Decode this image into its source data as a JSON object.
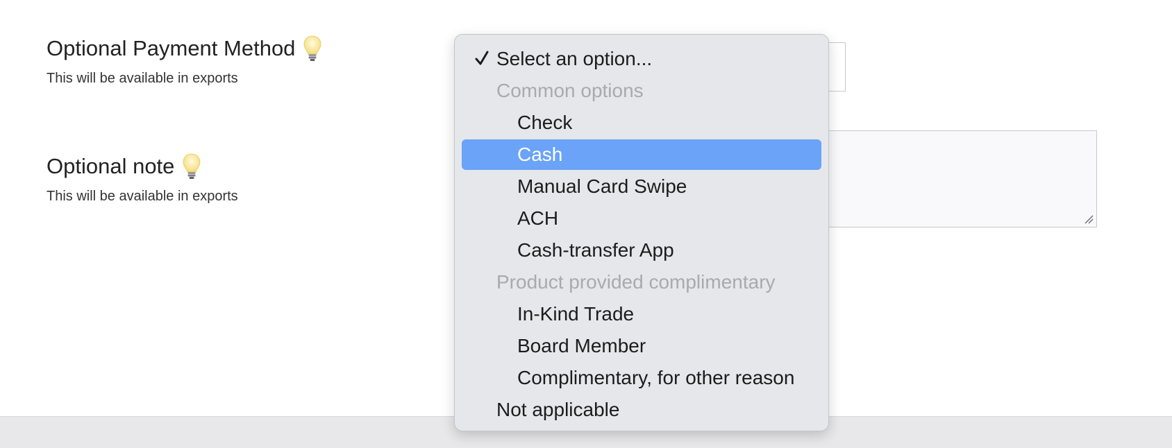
{
  "fields": {
    "payment_method": {
      "label": "Optional Payment Method",
      "help": "This will be available in exports",
      "icon": "lightbulb-icon"
    },
    "note": {
      "label": "Optional note",
      "help": "This will be available in exports",
      "icon": "lightbulb-icon"
    }
  },
  "dropdown": {
    "selected": "Select an option...",
    "highlighted": "Cash",
    "items": [
      {
        "label": "Select an option...",
        "kind": "option",
        "checked": true
      },
      {
        "label": "Common options",
        "kind": "group"
      },
      {
        "label": "Check",
        "kind": "option"
      },
      {
        "label": "Cash",
        "kind": "option",
        "highlighted": true
      },
      {
        "label": "Manual Card Swipe",
        "kind": "option"
      },
      {
        "label": "ACH",
        "kind": "option"
      },
      {
        "label": "Cash-transfer App",
        "kind": "option"
      },
      {
        "label": "Product provided complimentary",
        "kind": "group"
      },
      {
        "label": "In-Kind Trade",
        "kind": "option"
      },
      {
        "label": "Board Member",
        "kind": "option"
      },
      {
        "label": "Complimentary, for other reason",
        "kind": "option"
      },
      {
        "label": "Not applicable",
        "kind": "option"
      }
    ]
  },
  "colors": {
    "highlight": "#6aa3f7",
    "menu_background": "#e6e7ea",
    "group_header_text": "#a9aaae",
    "footer_bar": "#e8e8ea"
  }
}
